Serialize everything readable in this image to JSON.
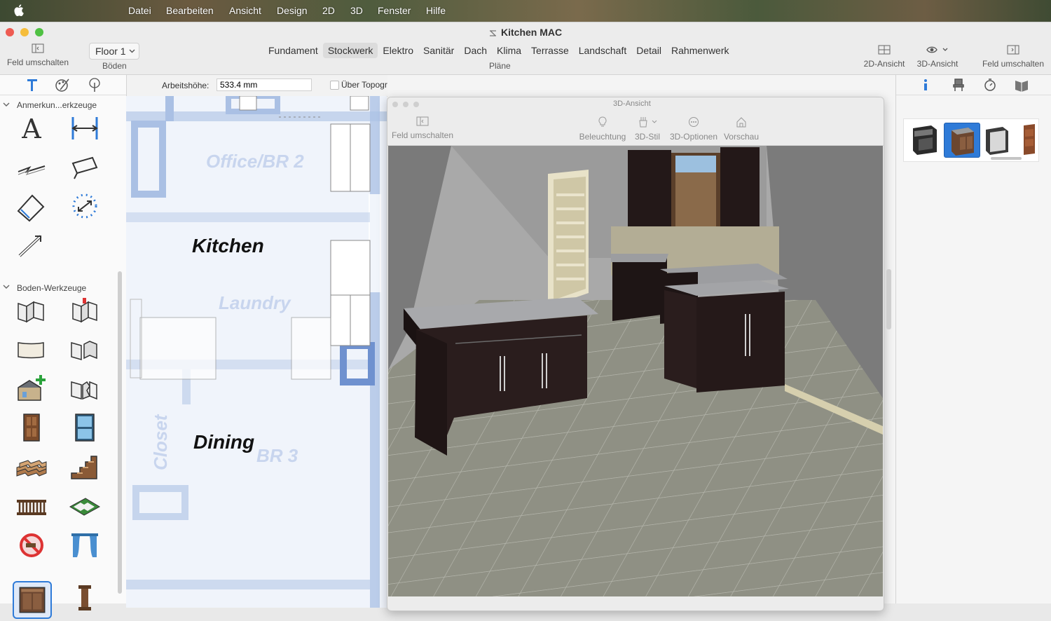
{
  "menubar": {
    "items": [
      "Datei",
      "Bearbeiten",
      "Ansicht",
      "Design",
      "2D",
      "3D",
      "Fenster",
      "Hilfe"
    ]
  },
  "window": {
    "title": "Kitchen MAC"
  },
  "toolbar": {
    "left_toggle_label": "Feld umschalten",
    "floor_select_value": "Floor 1",
    "floors_label": "Böden",
    "plans_label": "Pläne",
    "plan_tabs": [
      "Fundament",
      "Stockwerk",
      "Elektro",
      "Sanitär",
      "Dach",
      "Klima",
      "Terrasse",
      "Landschaft",
      "Detail",
      "Rahmenwerk"
    ],
    "active_plan_tab": "Stockwerk",
    "view2d_label": "2D-Ansicht",
    "view3d_label": "3D-Ansicht",
    "right_toggle_label": "Feld umschalten"
  },
  "sidebar": {
    "section_annotations": "Anmerkun...erkzeuge",
    "section_floor_tools": "Boden-Werkzeuge"
  },
  "options_bar": {
    "work_height_label": "Arbeitshöhe:",
    "work_height_value": "533.4 mm",
    "topo_label": "Über Topogr"
  },
  "plan": {
    "rooms": [
      "Kitchen",
      "Dining"
    ],
    "faded_rooms": [
      "Office/BR 2",
      "Laundry",
      "BR 3",
      "Closet"
    ]
  },
  "view3d_window": {
    "title": "3D-Ansicht",
    "toggle_label": "Feld umschalten",
    "lighting_label": "Beleuchtung",
    "style_label": "3D-Stil",
    "options_label": "3D-Optionen",
    "preview_label": "Vorschau"
  },
  "colors": {
    "accent": "#2f7bd8",
    "wall_plan": "#aac0e4",
    "cabinet": "#2a1d1d",
    "countertop": "#9fa0a3",
    "floor_tile": "#8d8e82"
  }
}
